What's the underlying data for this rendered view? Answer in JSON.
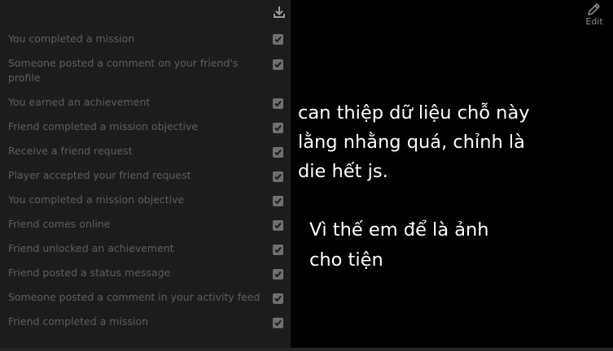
{
  "toolbar": {
    "download_icon": "download-icon",
    "edit_icon": "pencil-icon",
    "edit_label": "Edit"
  },
  "notifications": [
    {
      "label": "You completed a mission",
      "checked": true
    },
    {
      "label": "Someone posted a comment on your friend's profile",
      "checked": true
    },
    {
      "label": "You earned an achievement",
      "checked": true
    },
    {
      "label": "Friend completed a mission objective",
      "checked": true
    },
    {
      "label": "Receive a friend request",
      "checked": true
    },
    {
      "label": "Player accepted your friend request",
      "checked": true
    },
    {
      "label": "You completed a mission objective",
      "checked": true
    },
    {
      "label": "Friend comes online",
      "checked": true
    },
    {
      "label": "Friend unlocked an achievement",
      "checked": true
    },
    {
      "label": "Friend posted a status message",
      "checked": true
    },
    {
      "label": "Someone posted a comment in your activity feed",
      "checked": true
    },
    {
      "label": "Friend completed a mission",
      "checked": true
    }
  ],
  "annotation": {
    "line1": "can thiệp dữ liệu chỗ này",
    "line2": "lằng nhằng quá, chỉnh là",
    "line3": "die hết js.",
    "line4": "Vì thế em để là ảnh",
    "line5": "cho tiện"
  },
  "colors": {
    "background": "#000000",
    "panel": "#1c1c1c",
    "label_text": "#5c5c5c",
    "checkbox": "#6f6f6f",
    "annotation_text": "#ffffff"
  }
}
